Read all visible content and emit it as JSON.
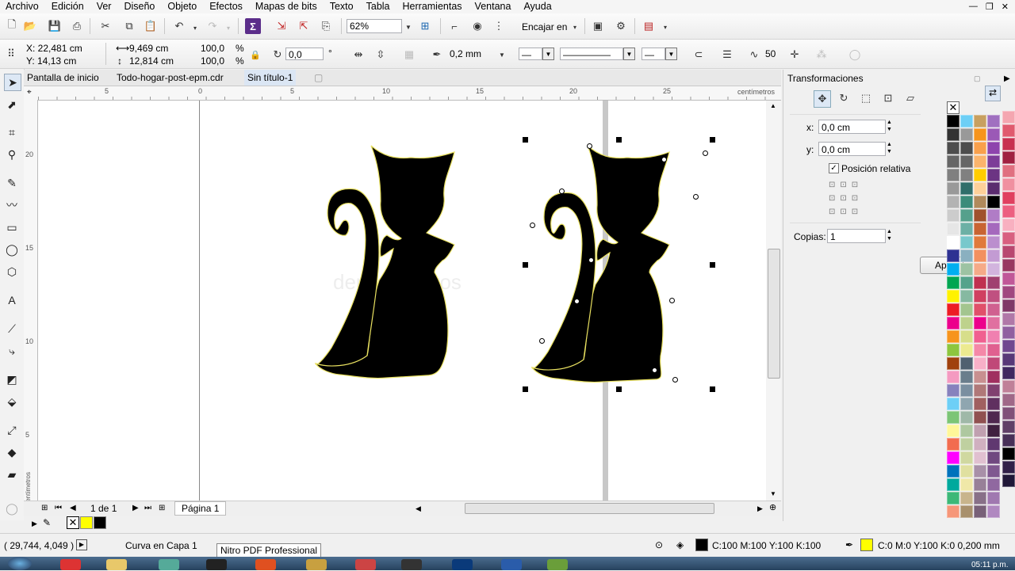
{
  "menu": [
    "Archivo",
    "Edición",
    "Ver",
    "Diseño",
    "Objeto",
    "Efectos",
    "Mapas de bits",
    "Texto",
    "Tabla",
    "Herramientas",
    "Ventana",
    "Ayuda"
  ],
  "toolbar": {
    "zoom": "62%",
    "snap": "Encajar en"
  },
  "propbar": {
    "x": "X: 22,481 cm",
    "y": "Y: 14,13 cm",
    "w": "9,469 cm",
    "h": "12,814 cm",
    "sx": "100,0",
    "sy": "100,0",
    "pct": "%",
    "rotation": "0,0",
    "deg": "°",
    "outline": "0,2 mm",
    "smooth": "50"
  },
  "tabs": [
    "Pantalla de inicio",
    "Todo-hogar-post-epm.cdr",
    "Sin título-1"
  ],
  "ruler": {
    "unit": "centímetros",
    "h_ticks": [
      "5",
      "0",
      "5",
      "10",
      "15",
      "20",
      "25"
    ],
    "v_ticks": [
      "20",
      "15",
      "10",
      "5"
    ],
    "v_unit": "centímetros"
  },
  "watermark": "depositphotos",
  "pagenav": {
    "count": "1 de 1",
    "page_tab": "Página 1"
  },
  "docker": {
    "title": "Transformaciones",
    "x_label": "x:",
    "x_value": "0,0 cm",
    "y_label": "y:",
    "y_value": "0,0 cm",
    "relative": "Posición relativa",
    "copies_label": "Copias:",
    "copies_value": "1",
    "apply": "Ap"
  },
  "status": {
    "coords": "( 29,744, 4,049 )",
    "object": "Curva en Capa 1",
    "tooltip": "Nitro PDF Professional",
    "fill": "C:100 M:100 Y:100 K:100",
    "outline": "C:0 M:0 Y:100 K:0  0,200 mm",
    "time": "05:11 p.m."
  },
  "colors": {
    "fill": "#000000",
    "outline": "#ffff00",
    "active_tab": "#dbe6f4"
  },
  "palette_col1": [
    "#000000",
    "#333333",
    "#4d4d4d",
    "#666666",
    "#808080",
    "#999999",
    "#b3b3b3",
    "#cccccc",
    "#e6e6e6",
    "#ffffff",
    "#2e3192",
    "#00aeef",
    "#00a651",
    "#fff200",
    "#ed1c24",
    "#ec008c",
    "#f7941d",
    "#8dc63f",
    "#a0410d",
    "#f49ac1",
    "#8781bd",
    "#6dcff6",
    "#7cc576",
    "#fff799",
    "#f26c4f",
    "#ff00ff",
    "#0072bc",
    "#00a99d",
    "#3cb878",
    "#f69679"
  ],
  "palette_col2": [
    "#6dcff6",
    "#999999",
    "#4d4d4d",
    "#666666",
    "#808080",
    "#2f6e6a",
    "#3c8c7a",
    "#55a08c",
    "#6cb0a5",
    "#78c8cc",
    "#8ab0c0",
    "#9dc3a3",
    "#55a38b",
    "#86b9a1",
    "#a3c58f",
    "#bed28c",
    "#d7de8a",
    "#ecea90",
    "#506070",
    "#6a7e8c",
    "#7a8fa0",
    "#8fa6b0",
    "#9fb8a8",
    "#aec8a0",
    "#bfd0a0",
    "#d0d8a0",
    "#e0e0a0",
    "#f0e8a8",
    "#c8b48c",
    "#a8906c"
  ],
  "palette_col3": [
    "#c8a060",
    "#f7941d",
    "#f9a04c",
    "#fbb46c",
    "#ffcc00",
    "#fdd099",
    "#b08a5c",
    "#a0522d",
    "#c86432",
    "#e07a3c",
    "#f29060",
    "#f5aa88",
    "#c03050",
    "#d04060",
    "#e0506a",
    "#ec008c",
    "#f06090",
    "#f488a8",
    "#f8b0c8",
    "#c89090",
    "#b07878",
    "#a06060",
    "#905050",
    "#c0a0b0",
    "#d0b0c0",
    "#e0c0d0",
    "#a890a8",
    "#988098",
    "#887088",
    "#786078"
  ],
  "palette_col4": [
    "#a070c0",
    "#9b59b6",
    "#8e44ad",
    "#7d3c98",
    "#6c3483",
    "#5b2c6f",
    "#000000",
    "#b07cc6",
    "#a569bd",
    "#bb8fce",
    "#c39bd3",
    "#d2b4de",
    "#a04070",
    "#c05080",
    "#d06090",
    "#e070a0",
    "#f080b0",
    "#e06090",
    "#c04878",
    "#a03060",
    "#804070",
    "#603060",
    "#502850",
    "#402040",
    "#603870",
    "#704880",
    "#805890",
    "#9068a0",
    "#a078b0",
    "#b088c0"
  ]
}
